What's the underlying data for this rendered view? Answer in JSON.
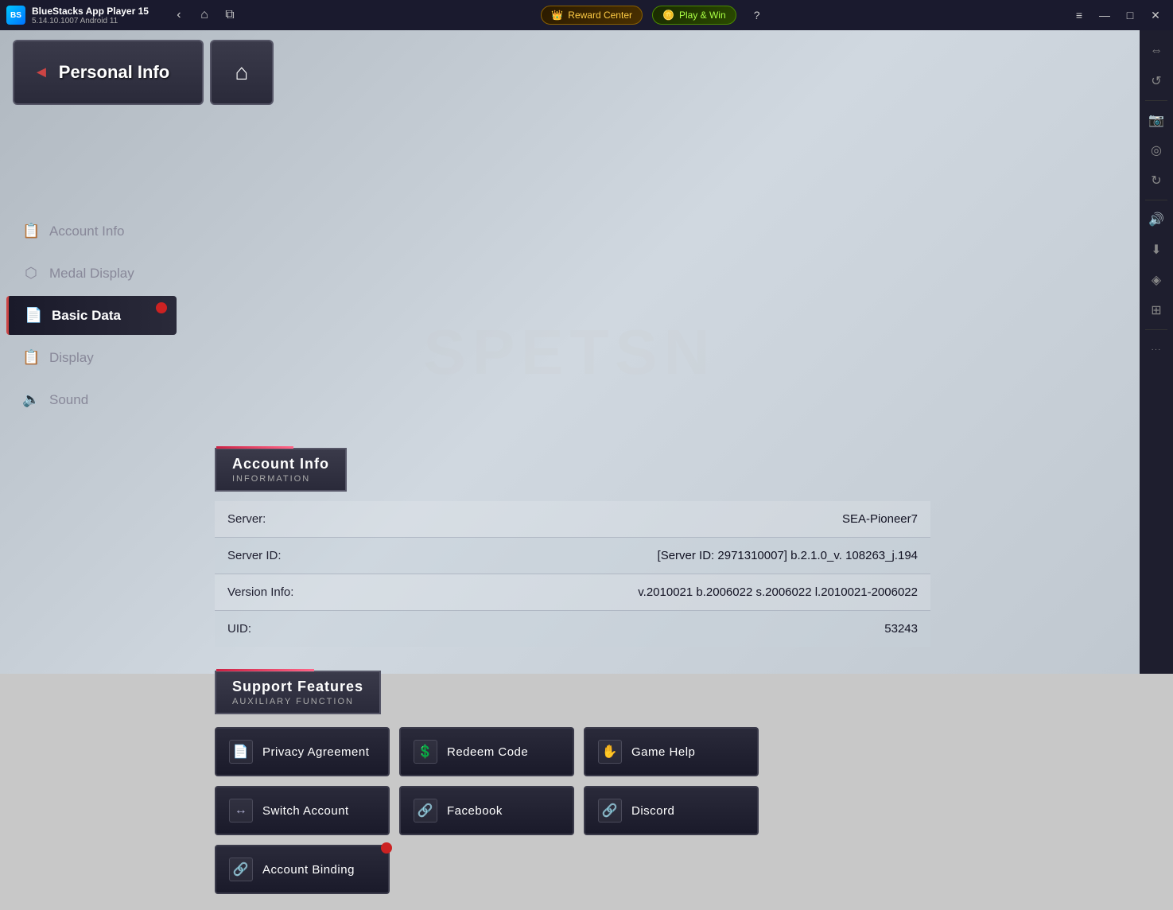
{
  "titlebar": {
    "app_name": "BlueStacks App Player 15",
    "app_version": "5.14.10.1007  Android 11",
    "nav_back": "‹",
    "nav_home": "⌂",
    "nav_tabs": "⧉",
    "reward_center_label": "Reward Center",
    "play_win_label": "Play & Win",
    "help_icon": "?",
    "menu_icon": "≡",
    "minimize_icon": "—",
    "maximize_icon": "□",
    "close_icon": "✕"
  },
  "game_header": {
    "personal_info_label": "Personal Info",
    "home_icon": "⌂"
  },
  "sidebar": {
    "items": [
      {
        "id": "account-info",
        "label": "Account Info",
        "icon": "📋",
        "active": false,
        "badge": false
      },
      {
        "id": "medal-display",
        "label": "Medal Display",
        "icon": "⬡",
        "active": false,
        "badge": false
      },
      {
        "id": "basic-data",
        "label": "Basic Data",
        "icon": "📄",
        "active": true,
        "badge": true
      },
      {
        "id": "display",
        "label": "Display",
        "icon": "📋",
        "active": false,
        "badge": false
      },
      {
        "id": "sound",
        "label": "Sound",
        "icon": "🔈",
        "active": false,
        "badge": false
      }
    ]
  },
  "account_info_section": {
    "title": "Account Info",
    "subtitle": "INFORMATION",
    "rows": [
      {
        "label": "Server:",
        "value": "SEA-Pioneer7"
      },
      {
        "label": "Server ID:",
        "value": "[Server ID: 2971310007] b.2.1.0_v. 108263_j.194"
      },
      {
        "label": "Version Info:",
        "value": "v.2010021 b.2006022 s.2006022 l.2010021-2006022"
      },
      {
        "label": "UID:",
        "value": "53243"
      }
    ]
  },
  "support_features_section": {
    "title": "Support Features",
    "subtitle": "AUXILIARY FUNCTION",
    "buttons": [
      {
        "id": "privacy-agreement",
        "label": "Privacy Agreement",
        "icon": "📄",
        "badge": false
      },
      {
        "id": "redeem-code",
        "label": "Redeem Code",
        "icon": "💲",
        "badge": false
      },
      {
        "id": "game-help",
        "label": "Game Help",
        "icon": "✋",
        "badge": false
      },
      {
        "id": "switch-account",
        "label": "Switch Account",
        "icon": "↔",
        "badge": false
      },
      {
        "id": "facebook",
        "label": "Facebook",
        "icon": "🔗",
        "badge": false
      },
      {
        "id": "discord",
        "label": "Discord",
        "icon": "🔗",
        "badge": false
      },
      {
        "id": "account-binding",
        "label": "Account Binding",
        "icon": "🔗",
        "badge": true
      }
    ]
  },
  "right_sidebar": {
    "buttons": [
      {
        "id": "expand",
        "icon": "⇔"
      },
      {
        "id": "rotate",
        "icon": "↺"
      },
      {
        "id": "screenshot",
        "icon": "📷"
      },
      {
        "id": "camera2",
        "icon": "◎"
      },
      {
        "id": "refresh",
        "icon": "↻"
      },
      {
        "id": "volume",
        "icon": "🔊"
      },
      {
        "id": "download",
        "icon": "⬇"
      },
      {
        "id": "location",
        "icon": "◈"
      },
      {
        "id": "gamepad",
        "icon": "⊞"
      },
      {
        "id": "more",
        "icon": "···"
      }
    ]
  },
  "watermark": "SPETSN"
}
